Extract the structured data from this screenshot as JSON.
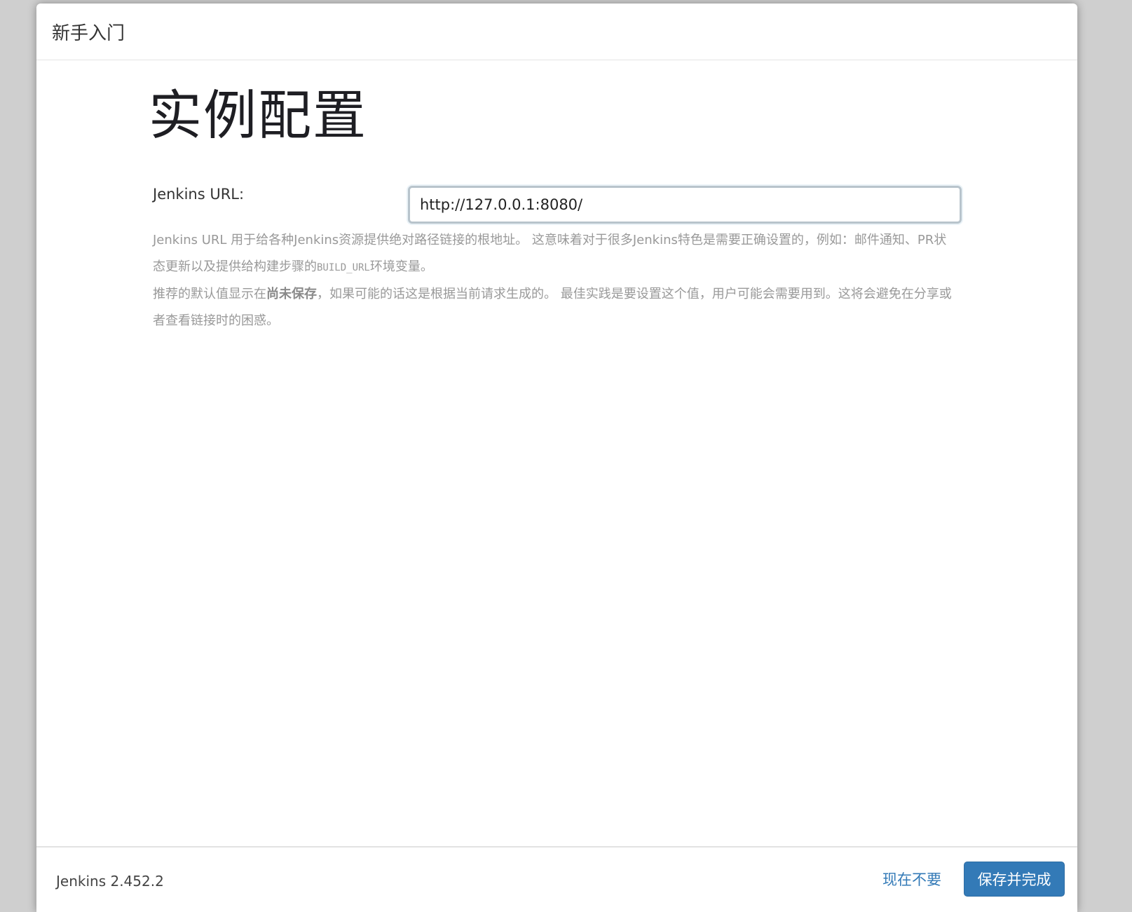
{
  "header": {
    "title": "新手入门"
  },
  "main": {
    "page_title": "实例配置",
    "url_label": "Jenkins URL:",
    "url_value": "http://127.0.0.1:8080/",
    "help": {
      "p1_before": "Jenkins URL 用于给各种Jenkins资源提供绝对路径链接的根地址。 这意味着对于很多Jenkins特色是需要正确设置的，例如：邮件通知、PR状态更新以及提供给构建步骤的",
      "p1_code": "BUILD_URL",
      "p1_after": "环境变量。",
      "p2_before": "推荐的默认值显示在",
      "p2_strong": "尚未保存",
      "p2_after": "，如果可能的话这是根据当前请求生成的。 最佳实践是要设置这个值，用户可能会需要用到。这将会避免在分享或者查看链接时的困惑。"
    }
  },
  "footer": {
    "version": "Jenkins 2.452.2",
    "skip_label": "现在不要",
    "save_label": "保存并完成"
  },
  "colors": {
    "accent": "#337ab7",
    "help_text": "#999999"
  }
}
